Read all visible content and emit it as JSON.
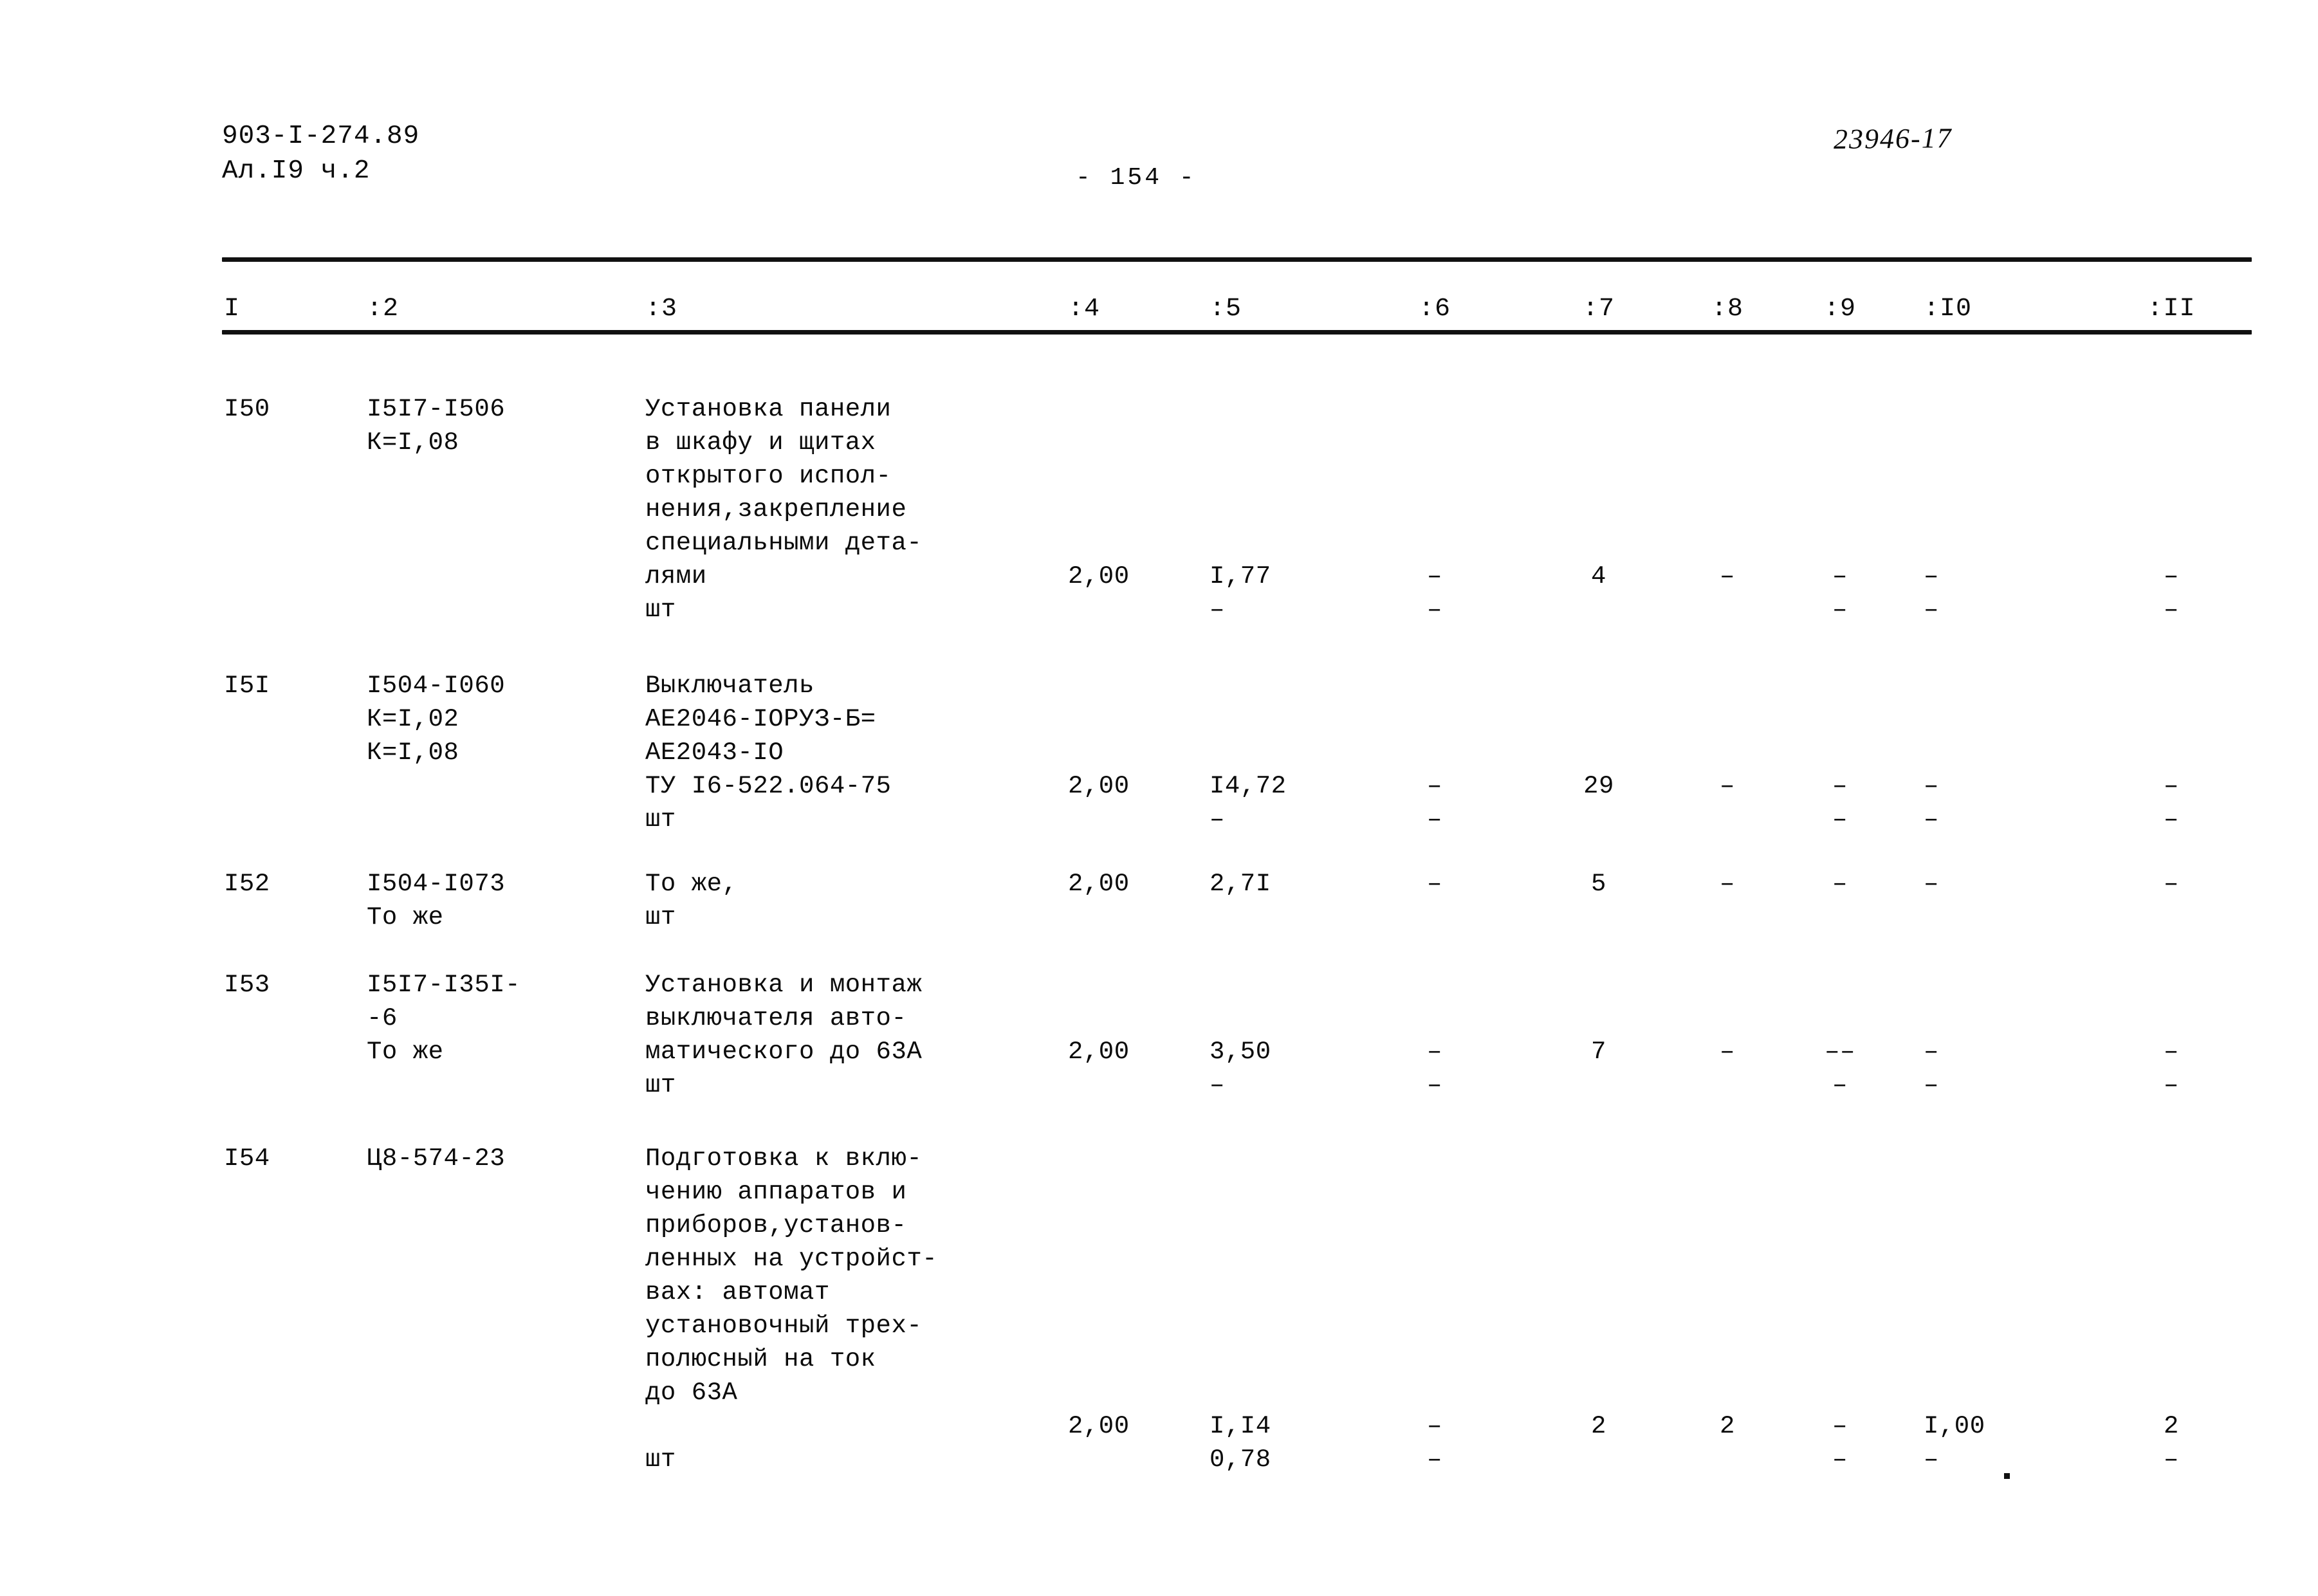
{
  "header": {
    "doc_code_line1": "903-I-274.89",
    "doc_code_line2": "Ал.I9 ч.2",
    "page_number": "- 154 -",
    "stamp": "23946-17"
  },
  "table": {
    "columns": [
      "I",
      ":2",
      ":3",
      ":4",
      ":5",
      ":6",
      ":7",
      ":8",
      ":9",
      ":I0",
      ":II"
    ],
    "rows": [
      {
        "num": "I50",
        "code": "I5I7-I506\nК=I,08",
        "desc": "Установка панели\nв шкафу и щитах\nоткрытого испол-\nнения,закрепление\nспециальными дета-\nлями",
        "unit": "шт",
        "c4": "2,00",
        "c5": "I,77",
        "c6": "–",
        "c7": "4",
        "c8": "–",
        "c9": "–",
        "c10": "–",
        "c11": "–",
        "c4b": "",
        "c5b": "–",
        "c6b": "–",
        "c7b": "",
        "c8b": "",
        "c9b": "–",
        "c10b": "–",
        "c11b": "–"
      },
      {
        "num": "I5I",
        "code": "I504-I060\nК=I,02\nК=I,08",
        "desc": "Выключатель\nАЕ2046-IОРУЗ-Б=\nАЕ2043-IО\nТУ I6-522.064-75",
        "unit": "шт",
        "c4": "2,00",
        "c5": "I4,72",
        "c6": "–",
        "c7": "29",
        "c8": "–",
        "c9": "–",
        "c10": "–",
        "c11": "–",
        "c4b": "",
        "c5b": "–",
        "c6b": "–",
        "c7b": "",
        "c8b": "",
        "c9b": "–",
        "c10b": "–",
        "c11b": "–"
      },
      {
        "num": "I52",
        "code": "I504-I073\nТо же",
        "desc": "То же,",
        "unit": "шт",
        "c4": "2,00",
        "c5": "2,7I",
        "c6": "–",
        "c7": "5",
        "c8": "–",
        "c9": "–",
        "c10": "–",
        "c11": "–",
        "c4b": "",
        "c5b": "",
        "c6b": "",
        "c7b": "",
        "c8b": "",
        "c9b": "",
        "c10b": "",
        "c11b": ""
      },
      {
        "num": "I53",
        "code": "I5I7-I35I-\n-6\nТо же",
        "desc": "Установка и монтаж\nвыключателя авто-\nматического до 63А",
        "unit": "шт",
        "c4": "2,00",
        "c5": "3,50",
        "c6": "–",
        "c7": "7",
        "c8": "–",
        "c9": "––",
        "c10": "–",
        "c11": "–",
        "c4b": "",
        "c5b": "–",
        "c6b": "–",
        "c7b": "",
        "c8b": "",
        "c9b": "–",
        "c10b": "–",
        "c11b": "–"
      },
      {
        "num": "I54",
        "code": "Ц8-574-23",
        "desc": "Подготовка к вклю-\nчению аппаратов и\nприборов,установ-\nленных на устройст-\nвах: автомат\nустановочный трех-\nполюсный на ток\nдо 63А",
        "unit": "шт",
        "c4": "2,00",
        "c5": "I,I4",
        "c6": "–",
        "c7": "2",
        "c8": "2",
        "c9": "–",
        "c10": "I,00",
        "c11": "2",
        "c4b": "",
        "c5b": "0,78",
        "c6b": "–",
        "c7b": "",
        "c8b": "",
        "c9b": "–",
        "c10b": "–",
        "c11b": "–"
      }
    ]
  }
}
